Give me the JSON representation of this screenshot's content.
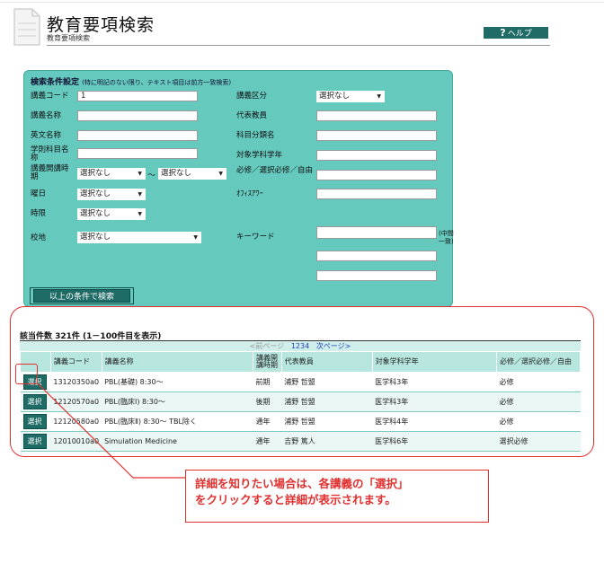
{
  "header": {
    "title": "教育要項検索",
    "subtitle": "教育要項検索",
    "help_label": "ヘルプ",
    "help_icon": "?"
  },
  "search": {
    "heading": "検索条件設定",
    "heading_note": "(特に明記のない限り、テキスト項目は前方一致検索)",
    "fields": {
      "course_code": {
        "label": "講義コード",
        "value": "1"
      },
      "course_name": {
        "label": "講義名称",
        "value": ""
      },
      "english_name": {
        "label": "英文名称",
        "value": ""
      },
      "subject_name": {
        "label": "学則科目名称",
        "value": ""
      },
      "period": {
        "label": "講義開講時期",
        "from": "選択なし",
        "to": "選択なし",
        "tilde": "～"
      },
      "weekday": {
        "label": "曜日",
        "value": "選択なし"
      },
      "time": {
        "label": "時限",
        "value": "選択なし"
      },
      "campus": {
        "label": "校地",
        "value": "選択なし"
      },
      "category": {
        "label": "講義区分",
        "value": "選択なし"
      },
      "teacher": {
        "label": "代表教員",
        "value": ""
      },
      "subject_class": {
        "label": "科目分類名",
        "value": ""
      },
      "target_year": {
        "label": "対象学科学年",
        "value": ""
      },
      "required": {
        "label": "必修／選択必修／自由",
        "value": ""
      },
      "office_hour": {
        "label": "ｵﾌｨｽｱﾜｰ",
        "value": ""
      },
      "keyword": {
        "label": "キーワード",
        "note": "(中間一致)"
      }
    },
    "search_button": "以上の条件で検索"
  },
  "results": {
    "count_text": "該当件数 321件 (1－100件目を表示)",
    "pager": {
      "prev": "<前ページ",
      "pages": "1234",
      "next": "次ページ>"
    },
    "headers": [
      "",
      "講義コード",
      "講義名称",
      "講義開講時期",
      "代表教員",
      "対象学科学年",
      "必修／選択必修／自由"
    ],
    "select_label": "選択",
    "rows": [
      {
        "code": "13120350a0",
        "name": "PBL(基礎) 8:30～",
        "period": "前期",
        "teacher": "浦野 哲盟",
        "year": "医学科3年",
        "req": "必修"
      },
      {
        "code": "12120570a0",
        "name": "PBL(臨床Ⅰ) 8:30～",
        "period": "後期",
        "teacher": "浦野 哲盟",
        "year": "医学科3年",
        "req": "必修"
      },
      {
        "code": "12120580a0",
        "name": "PBL(臨床Ⅱ) 8:30～ TBL除く",
        "period": "通年",
        "teacher": "浦野 哲盟",
        "year": "医学科4年",
        "req": "必修"
      },
      {
        "code": "12010010a0",
        "name": "Simulation Medicine",
        "period": "通年",
        "teacher": "吉野 篤人",
        "year": "医学科6年",
        "req": "選択必修"
      }
    ]
  },
  "annotation": {
    "line1": "詳細を知りたい場合は、各講義の「選択」",
    "line2": "をクリックすると詳細が表示されます。",
    "accent": "#e03030"
  }
}
